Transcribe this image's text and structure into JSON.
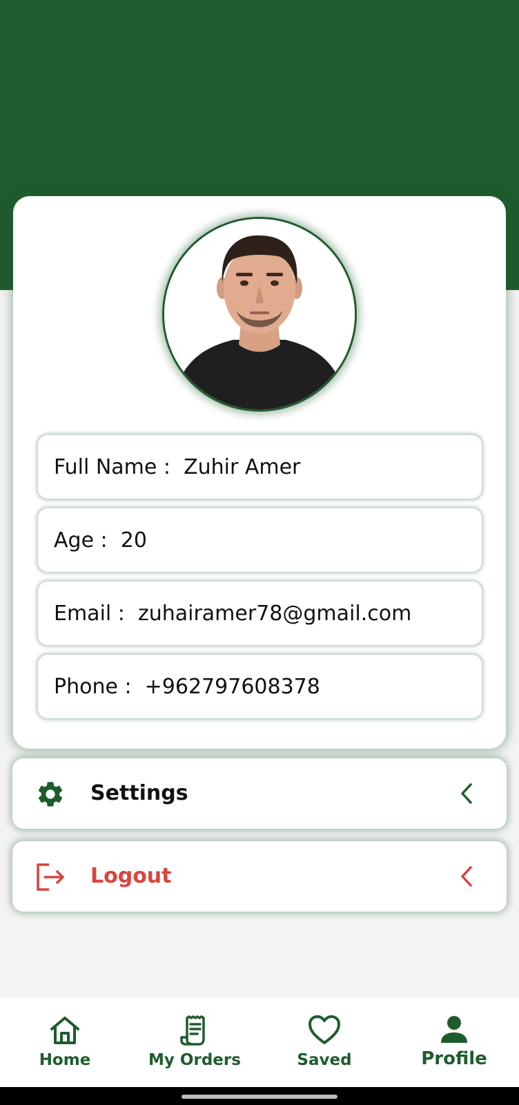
{
  "profile": {
    "fields": [
      {
        "label": "Full Name :",
        "value": "Zuhir Amer"
      },
      {
        "label": "Age :",
        "value": "20"
      },
      {
        "label": "Email :",
        "value": "zuhairamer78@gmail.com"
      },
      {
        "label": "Phone :",
        "value": "+962797608378"
      }
    ]
  },
  "menu": {
    "settings_label": "Settings",
    "logout_label": "Logout"
  },
  "nav": {
    "items": [
      {
        "label": "Home",
        "icon": "home-icon"
      },
      {
        "label": "My Orders",
        "icon": "orders-icon"
      },
      {
        "label": "Saved",
        "icon": "heart-icon"
      },
      {
        "label": "Profile",
        "icon": "person-icon",
        "active": true
      }
    ]
  },
  "colors": {
    "primary": "#1e5c2e",
    "danger": "#d9443c",
    "background": "#f3f3f3"
  }
}
